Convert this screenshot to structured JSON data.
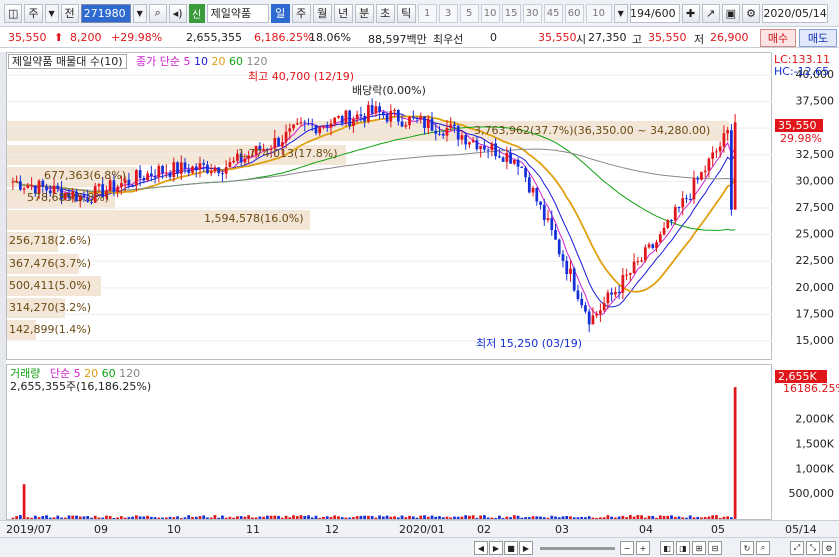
{
  "toolbar": {
    "market": "주",
    "filter": "전",
    "code": "271980",
    "name": "제일약품",
    "sin_label": "신",
    "periods": [
      "일",
      "주",
      "월",
      "년",
      "분",
      "초",
      "틱"
    ],
    "active_period": "일",
    "intervals": [
      "1",
      "3",
      "5",
      "10",
      "15",
      "30",
      "45",
      "60"
    ],
    "interval_value": "10",
    "count": "194/600",
    "date": "2020/05/14"
  },
  "quote": {
    "price": "35,550",
    "change": "8,200",
    "change_pct": "+29.98%",
    "volume": "2,655,355",
    "volume_pct": "6,186.25%",
    "turnover_pct": "18.06%",
    "amount": "88,597백만",
    "pref_label": "최우선",
    "pref_value": "0",
    "best_price": "35,550",
    "open_label": "시",
    "open": "27,350",
    "high_label": "고",
    "high": "35,550",
    "low_label": "저",
    "low": "26,900",
    "buy_label": "매수",
    "sell_label": "매도"
  },
  "price_legend": {
    "title": "제일약품 매물대 수(10)",
    "ma_label": "종가 단순",
    "ma_periods": [
      "5",
      "10",
      "20",
      "60",
      "120"
    ],
    "lc": "LC:133.11",
    "hc": "HC:-12.65"
  },
  "annotations": {
    "high": "최고 40,700 (12/19)",
    "dividend": "배당락(0.00%)",
    "low": "최저 15,250 (03/19)",
    "last_price": "35,550",
    "last_pct": "29.98%"
  },
  "volume_profile": [
    {
      "label": "3,763,962(37.7%)(36,350.00 ~ 34,280.00)",
      "frac": 1.0
    },
    {
      "label": "1,774,013(17.8%)",
      "frac": 0.47
    },
    {
      "label": "677,363(6.8%)",
      "frac": 0.18
    },
    {
      "label": "578,685(5.8%)",
      "frac": 0.15
    },
    {
      "label": "1,594,578(16.0%)",
      "frac": 0.42
    },
    {
      "label": "256,718(2.6%)",
      "frac": 0.07
    },
    {
      "label": "367,476(3.7%)",
      "frac": 0.1
    },
    {
      "label": "500,411(5.0%)",
      "frac": 0.13
    },
    {
      "label": "314,270(3.2%)",
      "frac": 0.08
    },
    {
      "label": "142,899(1.4%)",
      "frac": 0.04
    }
  ],
  "volume_legend": {
    "title": "거래량",
    "ma_label": "단순",
    "ma_periods": [
      "5",
      "20",
      "60",
      "120"
    ],
    "current": "2,655,355주(16,186.25%)",
    "last_value": "2,655K",
    "last_pct": "16186.25%"
  },
  "price_axis": [
    "40,000",
    "37,500",
    "32,500",
    "30,000",
    "27,500",
    "25,000",
    "22,500",
    "20,000",
    "17,500",
    "15,000"
  ],
  "volume_axis": [
    "2,000K",
    "1,500K",
    "1,000K",
    "500,000"
  ],
  "x_labels": [
    "2019/07",
    "09",
    "10",
    "11",
    "12",
    "2020/01",
    "02",
    "03",
    "04",
    "05"
  ],
  "x_last": "05/14",
  "chart_data": {
    "type": "candlestick",
    "title": "",
    "price_range": [
      13500,
      41500
    ],
    "close_approx": [
      [
        "2019/07",
        30000
      ],
      [
        "2019/08",
        28500
      ],
      [
        "2019/09",
        31000
      ],
      [
        "2019/10",
        31500
      ],
      [
        "2019/11",
        35000
      ],
      [
        "2019/12",
        36500
      ],
      [
        "2020/01",
        35000
      ],
      [
        "2020/02",
        32000
      ],
      [
        "2020/03",
        17000
      ],
      [
        "2020/04",
        25000
      ],
      [
        "2020/05",
        35550
      ]
    ],
    "high": 40700,
    "low": 15250
  },
  "colors": {
    "up": "#e0161a",
    "down": "#1530d8",
    "ma5": "#d020d0",
    "ma10": "#1a1ad8",
    "ma20": "#e0a010",
    "ma60": "#10a010",
    "ma120": "#888888",
    "profile": "#f3e6d6"
  }
}
